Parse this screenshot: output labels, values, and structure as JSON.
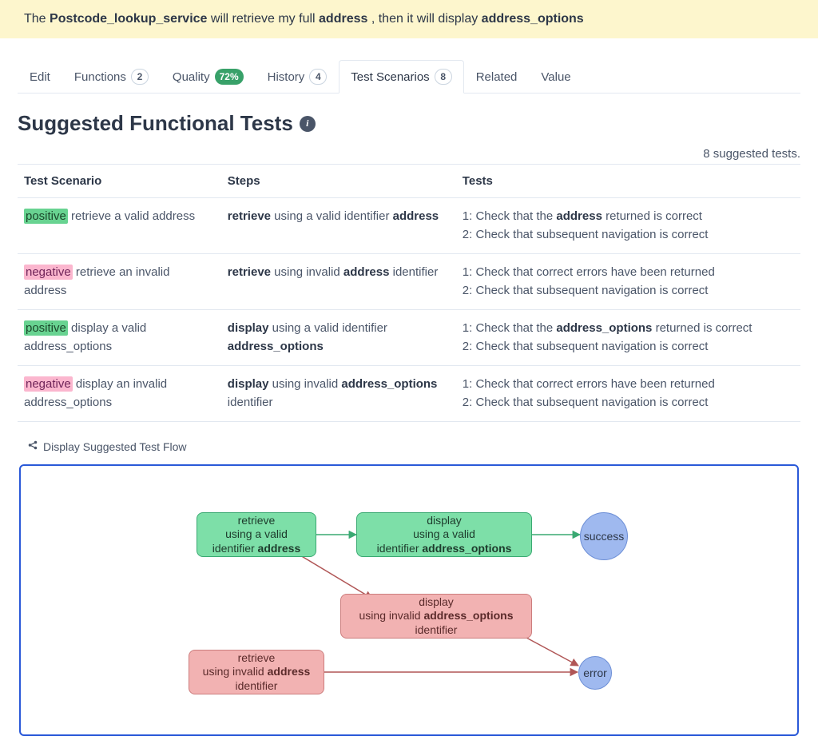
{
  "banner": {
    "prefix": "The ",
    "service": "Postcode_lookup_service",
    "mid1": " will retrieve my full ",
    "word1": "address",
    "mid2": " , then it will display ",
    "word2": "address_options"
  },
  "tabs": {
    "edit": "Edit",
    "functions": {
      "label": "Functions",
      "count": "2"
    },
    "quality": {
      "label": "Quality",
      "pct": "72%"
    },
    "history": {
      "label": "History",
      "count": "4"
    },
    "scenarios": {
      "label": "Test Scenarios",
      "count": "8"
    },
    "related": "Related",
    "value": "Value"
  },
  "section_title": "Suggested Functional Tests",
  "summary_count": "8 suggested tests.",
  "headers": {
    "scenario": "Test Scenario",
    "steps": "Steps",
    "tests": "Tests"
  },
  "rows": [
    {
      "tag": "positive",
      "tagClass": "pos",
      "scenario_rest": " retrieve a valid address",
      "step_bold1": "retrieve",
      "step_mid": " using a valid identifier ",
      "step_bold2": "address",
      "step_tail": "",
      "t1a": "1: Check that the ",
      "t1b": "address",
      "t1c": " returned is correct",
      "t2": "2: Check that subsequent navigation is correct"
    },
    {
      "tag": "negative",
      "tagClass": "neg",
      "scenario_rest": " retrieve an invalid address",
      "step_bold1": "retrieve",
      "step_mid": " using invalid ",
      "step_bold2": "address",
      "step_tail": " identifier",
      "t1a": "1: Check that correct errors have been returned",
      "t1b": "",
      "t1c": "",
      "t2": "2: Check that subsequent navigation is correct"
    },
    {
      "tag": "positive",
      "tagClass": "pos",
      "scenario_rest": " display a valid address_options",
      "step_bold1": "display",
      "step_mid": " using a valid identifier ",
      "step_bold2": "address_options",
      "step_tail": "",
      "t1a": "1: Check that the ",
      "t1b": "address_options",
      "t1c": " returned is correct",
      "t2": "2: Check that subsequent navigation is correct"
    },
    {
      "tag": "negative",
      "tagClass": "neg",
      "scenario_rest": " display an invalid address_options",
      "step_bold1": "display",
      "step_mid": " using invalid ",
      "step_bold2": "address_options",
      "step_tail": " identifier",
      "t1a": "1: Check that correct errors have been returned",
      "t1b": "",
      "t1c": "",
      "t2": "2: Check that subsequent navigation is correct"
    }
  ],
  "flow_toggle": "Display Suggested Test Flow",
  "flow": {
    "n1": {
      "l1": "retrieve",
      "l2": "using a valid",
      "l3a": "identifier ",
      "l3b": "address"
    },
    "n2": {
      "l1": "display",
      "l2": "using a valid",
      "l3a": "identifier ",
      "l3b": "address_options"
    },
    "n3": {
      "l1": "display",
      "l2a": "using invalid ",
      "l2b": "address_options",
      "l3": "identifier"
    },
    "n4": {
      "l1": "retrieve",
      "l2a": "using invalid ",
      "l2b": "address",
      "l3": "identifier"
    },
    "success": "success",
    "error": "error"
  }
}
